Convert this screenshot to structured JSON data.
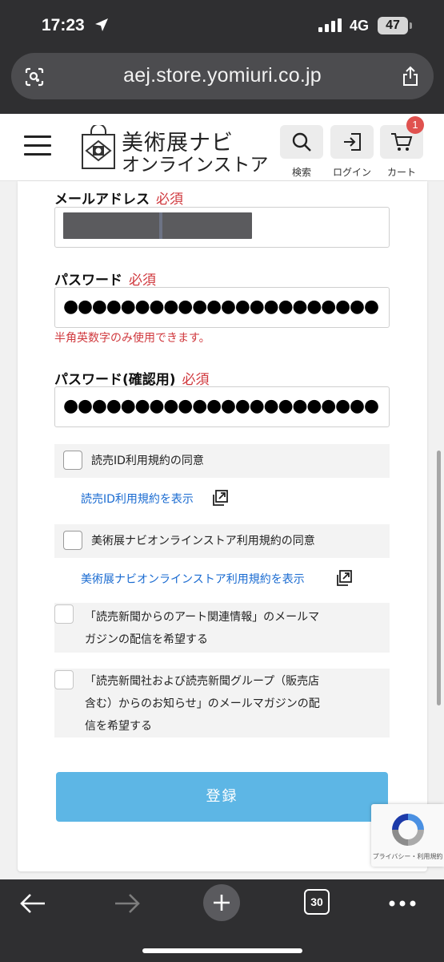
{
  "status_bar": {
    "time": "17:23",
    "network": "4G",
    "battery": "47"
  },
  "url_bar": {
    "url": "aej.store.yomiuri.co.jp"
  },
  "header": {
    "logo_line1": "美術展ナビ",
    "logo_line2": "オンラインストア",
    "search_label": "検索",
    "login_label": "ログイン",
    "cart_label": "カート",
    "cart_count": "1"
  },
  "form": {
    "email_label": "メールアドレス",
    "required": "必須",
    "password_label": "パスワード",
    "password_value": "●●●●●●●●●●●●●●●●●●●●●●",
    "password_hint": "半角英数字のみ使用できます。",
    "password_confirm_label": "パスワード(確認用)",
    "password_confirm_value": "●●●●●●●●●●●●●●●●●●●●●●",
    "agree_yomiuri_id": "読売ID利用規約の同意",
    "link_yomiuri_id": "読売ID利用規約を表示",
    "agree_store": "美術展ナビオンラインストア利用規約の同意",
    "link_store": "美術展ナビオンラインストア利用規約を表示",
    "newsletter_art_line1": "「読売新聞からのアート関連情報」のメールマ",
    "newsletter_art_line2": "ガジンの配信を希望する",
    "newsletter_group_line1": "「読売新聞社および読売新聞グループ（販売店",
    "newsletter_group_line2": "含む）からのお知らせ」のメールマガジンの配",
    "newsletter_group_line3": "信を希望する",
    "submit_label": "登録"
  },
  "recaptcha": {
    "footer": "プライバシー・利用規約"
  },
  "toolbar": {
    "tab_count": "30"
  },
  "colors": {
    "accent": "#5db6e5",
    "required": "#d0393e",
    "link": "#1a6bd1",
    "badge": "#e0524f"
  },
  "icons": [
    "location-arrow-icon",
    "signal-icon",
    "lens-icon",
    "share-icon",
    "hamburger-icon",
    "shopping-bag-logo-icon",
    "search-icon",
    "login-icon",
    "cart-icon",
    "external-link-icon",
    "recaptcha-icon",
    "back-arrow-icon",
    "forward-arrow-icon",
    "plus-icon",
    "tabs-icon",
    "more-icon"
  ]
}
